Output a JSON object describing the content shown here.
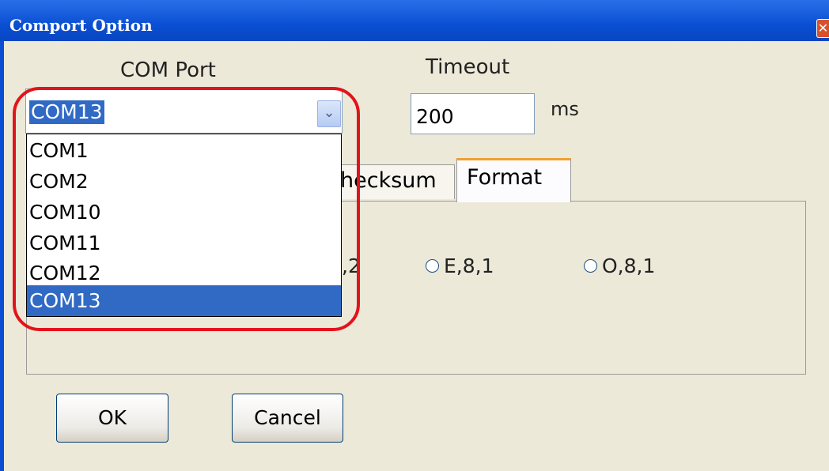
{
  "window": {
    "title": "Comport Option",
    "close_icon": "✕"
  },
  "com_port": {
    "label": "COM Port",
    "selected": "COM13",
    "options": [
      "COM1",
      "COM2",
      "COM10",
      "COM11",
      "COM12",
      "COM13"
    ],
    "selected_index": 5,
    "dropdown_arrow": "⌄"
  },
  "timeout": {
    "label": "Timeout",
    "value": "200",
    "unit": "ms"
  },
  "tabs": {
    "checksum_label": "hecksum",
    "format_label": "Format"
  },
  "format_options": {
    "partial_option": ",2",
    "option_e": "E,8,1",
    "option_o": "O,8,1"
  },
  "buttons": {
    "ok": "OK",
    "cancel": "Cancel"
  },
  "colors": {
    "titlebar": "#0a4fd3",
    "selection": "#316ac5",
    "highlight": "#e3131b",
    "dialog_bg": "#ece9d8"
  }
}
